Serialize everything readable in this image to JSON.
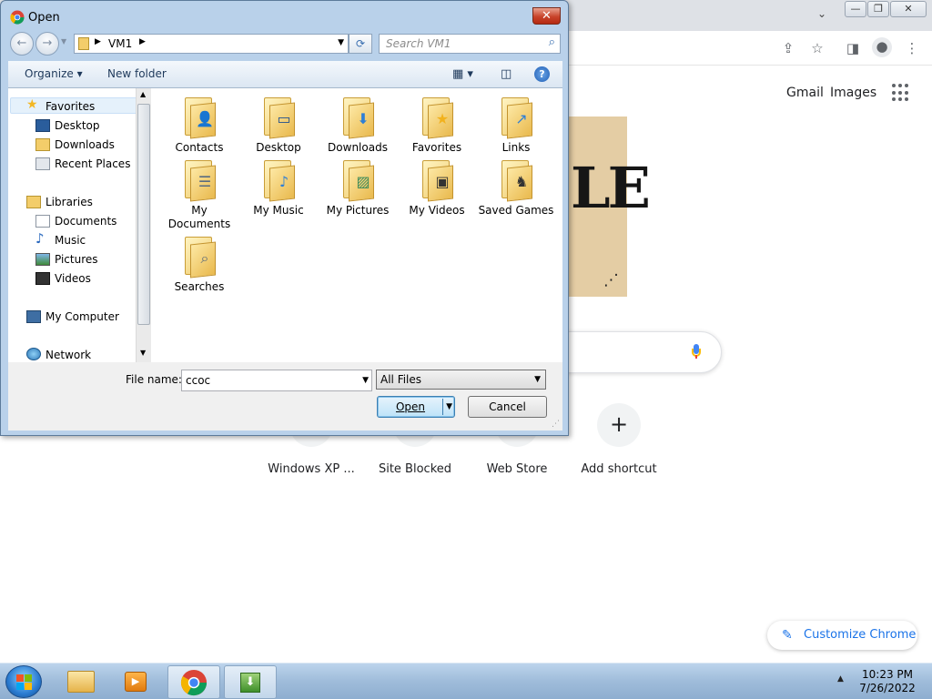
{
  "browser": {
    "links": {
      "gmail": "Gmail",
      "images": "Images"
    },
    "doodle_text": "LE",
    "shortcuts": [
      {
        "label": "Windows XP ..."
      },
      {
        "label": "Site Blocked"
      },
      {
        "label": "Web Store"
      },
      {
        "label": "Add shortcut"
      }
    ],
    "customize_label": "Customize Chrome"
  },
  "dialog": {
    "title": "Open",
    "close_glyph": "✕",
    "breadcrumb": [
      "VM1"
    ],
    "search_placeholder": "Search VM1",
    "commands": {
      "organize": "Organize",
      "new_folder": "New folder"
    },
    "nav": {
      "favorites": "Favorites",
      "favorites_items": [
        "Desktop",
        "Downloads",
        "Recent Places"
      ],
      "libraries": "Libraries",
      "libraries_items": [
        "Documents",
        "Music",
        "Pictures",
        "Videos"
      ],
      "computer": "My Computer",
      "network": "Network"
    },
    "folders": [
      {
        "label": "Contacts",
        "icon": "contacts-badge"
      },
      {
        "label": "Desktop",
        "icon": "desktop-badge"
      },
      {
        "label": "Downloads",
        "icon": "downloads-badge"
      },
      {
        "label": "Favorites",
        "icon": "favorites-badge"
      },
      {
        "label": "Links",
        "icon": "links-badge"
      },
      {
        "label": "My Documents",
        "icon": "documents-badge"
      },
      {
        "label": "My Music",
        "icon": "music-badge"
      },
      {
        "label": "My Pictures",
        "icon": "pictures-badge"
      },
      {
        "label": "My Videos",
        "icon": "videos-badge"
      },
      {
        "label": "Saved Games",
        "icon": "games-badge"
      },
      {
        "label": "Searches",
        "icon": "search-badge"
      }
    ],
    "filename_label": "File name:",
    "filename_value": "ccoc",
    "filter_value": "All Files",
    "open_label": "Open",
    "cancel_label": "Cancel"
  },
  "taskbar": {
    "time": "10:23 PM",
    "date": "7/26/2022"
  }
}
